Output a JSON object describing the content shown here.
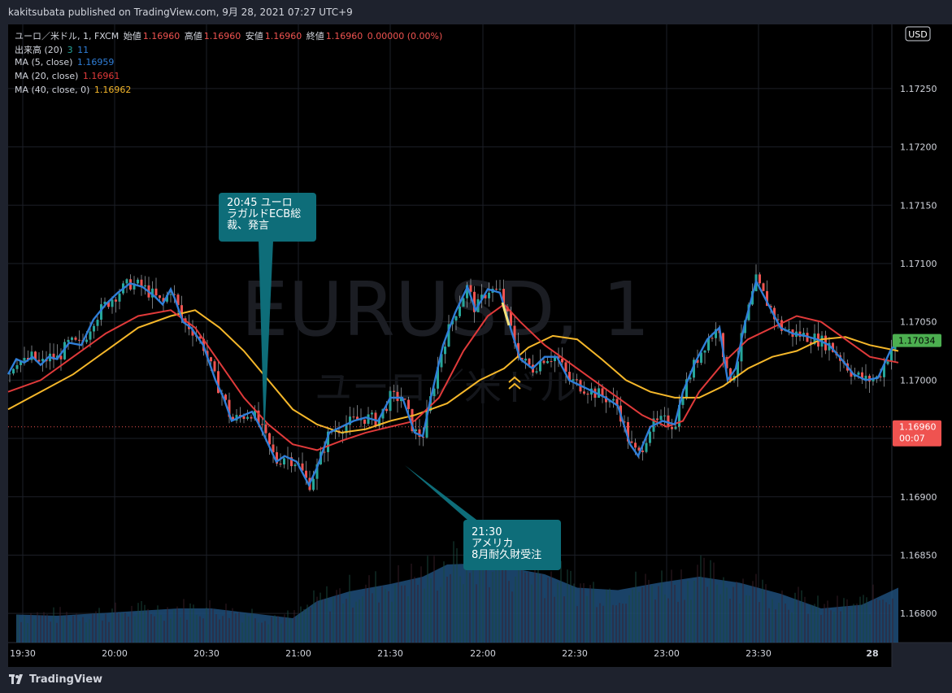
{
  "header": {
    "published_by": "kakitsubata published on TradingView.com, 9月 28, 2021 07:27 UTC+9"
  },
  "legend": {
    "symbol": "ユーロ／米ドル, 1, FXCM",
    "open_label": "始値",
    "open": "1.16960",
    "high_label": "高値",
    "high": "1.16960",
    "low_label": "安値",
    "low": "1.16960",
    "close_label": "終値",
    "close": "1.16960",
    "change": "0.00000 (0.00%)",
    "volume_label": "出来高 (20)",
    "volume_v1": "3",
    "volume_v2": "11",
    "ma5_label": "MA (5, close)",
    "ma5_value": "1.16959",
    "ma20_label": "MA (20, close)",
    "ma20_value": "1.16961",
    "ma40_label": "MA (40, close, 0)",
    "ma40_value": "1.16962"
  },
  "watermark": {
    "line1": "EURUSD, 1",
    "line2": "ユーロ／米ドル"
  },
  "currency_badge": "USD",
  "price_tags": {
    "last_price": "1.17034",
    "current_price": "1.16960",
    "countdown": "00:07"
  },
  "annotations": [
    {
      "text_line1": "20:45 ユーロ",
      "text_line2": "ラガルドECB総",
      "text_line3": "裁、発言"
    },
    {
      "text_line1": "21:30",
      "text_line2": "アメリカ",
      "text_line3": "8月耐久財受注"
    }
  ],
  "brand": "TradingView",
  "colors": {
    "background": "#000000",
    "panel": "#1e222d",
    "up": "#26a69a",
    "down": "#ef5350",
    "ma5": "#2f7ed8",
    "ma20": "#e03a3a",
    "ma40": "#f5b72a",
    "volume": "#1f4e79",
    "callout": "#0e6d79",
    "last_tag": "#4caf50",
    "current_tag": "#ef5350"
  },
  "chart_data": {
    "type": "candlestick",
    "y_ticks": [
      "1.17250",
      "1.17200",
      "1.17150",
      "1.17100",
      "1.17050",
      "1.17000",
      "1.16950",
      "1.16900",
      "1.16850",
      "1.16800"
    ],
    "x_ticks": [
      "19:30",
      "20:00",
      "20:30",
      "21:00",
      "21:30",
      "22:00",
      "22:30",
      "23:00",
      "23:30",
      "28"
    ],
    "ylim": [
      1.16775,
      1.17305
    ],
    "grid": true,
    "price_path": [
      [
        0,
        1.17005
      ],
      [
        10,
        1.17018
      ],
      [
        20,
        1.17015
      ],
      [
        30,
        1.1702
      ],
      [
        40,
        1.17013
      ],
      [
        50,
        1.1702
      ],
      [
        60,
        1.17018
      ],
      [
        75,
        1.17032
      ],
      [
        90,
        1.1703
      ],
      [
        105,
        1.17052
      ],
      [
        120,
        1.17065
      ],
      [
        135,
        1.17075
      ],
      [
        150,
        1.17083
      ],
      [
        165,
        1.1708
      ],
      [
        180,
        1.17072
      ],
      [
        190,
        1.17065
      ],
      [
        200,
        1.17078
      ],
      [
        205,
        1.1707
      ],
      [
        215,
        1.1705
      ],
      [
        225,
        1.17045
      ],
      [
        240,
        1.1703
      ],
      [
        255,
        1.17
      ],
      [
        265,
        1.16985
      ],
      [
        275,
        1.16965
      ],
      [
        290,
        1.1697
      ],
      [
        300,
        1.16973
      ],
      [
        310,
        1.1696
      ],
      [
        320,
        1.16945
      ],
      [
        330,
        1.1693
      ],
      [
        340,
        1.16935
      ],
      [
        355,
        1.1693
      ],
      [
        370,
        1.1691
      ],
      [
        380,
        1.16925
      ],
      [
        395,
        1.16955
      ],
      [
        410,
        1.1696
      ],
      [
        425,
        1.16965
      ],
      [
        440,
        1.16968
      ],
      [
        455,
        1.16965
      ],
      [
        470,
        1.16985
      ],
      [
        485,
        1.16985
      ],
      [
        500,
        1.16955
      ],
      [
        510,
        1.16952
      ],
      [
        520,
        1.16985
      ],
      [
        535,
        1.1703
      ],
      [
        550,
        1.17058
      ],
      [
        565,
        1.1708
      ],
      [
        575,
        1.1706
      ],
      [
        590,
        1.17078
      ],
      [
        605,
        1.17075
      ],
      [
        620,
        1.1704
      ],
      [
        630,
        1.17018
      ],
      [
        645,
        1.1701
      ],
      [
        660,
        1.1702
      ],
      [
        675,
        1.1702
      ],
      [
        690,
        1.17
      ],
      [
        705,
        1.16995
      ],
      [
        720,
        1.1699
      ],
      [
        735,
        1.16985
      ],
      [
        750,
        1.16978
      ],
      [
        765,
        1.16945
      ],
      [
        775,
        1.16935
      ],
      [
        790,
        1.1696
      ],
      [
        805,
        1.16965
      ],
      [
        820,
        1.16962
      ],
      [
        830,
        1.1699
      ],
      [
        845,
        1.17015
      ],
      [
        860,
        1.17035
      ],
      [
        875,
        1.17045
      ],
      [
        885,
        1.17
      ],
      [
        895,
        1.1701
      ],
      [
        905,
        1.17045
      ],
      [
        920,
        1.17085
      ],
      [
        935,
        1.17065
      ],
      [
        950,
        1.17045
      ],
      [
        965,
        1.1704
      ],
      [
        980,
        1.17038
      ],
      [
        995,
        1.17035
      ],
      [
        1010,
        1.1703
      ],
      [
        1025,
        1.17018
      ],
      [
        1040,
        1.17005
      ],
      [
        1055,
        1.17
      ],
      [
        1070,
        1.17002
      ],
      [
        1085,
        1.17025
      ],
      [
        1095,
        1.17034
      ]
    ],
    "ma20_path": [
      [
        0,
        1.1699
      ],
      [
        40,
        1.17
      ],
      [
        80,
        1.1702
      ],
      [
        120,
        1.1704
      ],
      [
        160,
        1.17055
      ],
      [
        200,
        1.1706
      ],
      [
        230,
        1.17045
      ],
      [
        260,
        1.17015
      ],
      [
        290,
        1.16985
      ],
      [
        320,
        1.16962
      ],
      [
        350,
        1.16945
      ],
      [
        380,
        1.1694
      ],
      [
        410,
        1.16948
      ],
      [
        440,
        1.16955
      ],
      [
        470,
        1.1696
      ],
      [
        500,
        1.16965
      ],
      [
        530,
        1.16985
      ],
      [
        560,
        1.17025
      ],
      [
        590,
        1.17055
      ],
      [
        610,
        1.17065
      ],
      [
        630,
        1.1705
      ],
      [
        660,
        1.1703
      ],
      [
        690,
        1.17015
      ],
      [
        720,
        1.17
      ],
      [
        750,
        1.16985
      ],
      [
        780,
        1.1697
      ],
      [
        810,
        1.1696
      ],
      [
        830,
        1.16965
      ],
      [
        850,
        1.1699
      ],
      [
        880,
        1.17015
      ],
      [
        910,
        1.17035
      ],
      [
        940,
        1.17045
      ],
      [
        970,
        1.17055
      ],
      [
        1000,
        1.1705
      ],
      [
        1030,
        1.17035
      ],
      [
        1060,
        1.1702
      ],
      [
        1095,
        1.17015
      ]
    ],
    "ma40_path": [
      [
        0,
        1.16975
      ],
      [
        40,
        1.1699
      ],
      [
        80,
        1.17005
      ],
      [
        120,
        1.17025
      ],
      [
        160,
        1.17045
      ],
      [
        200,
        1.17055
      ],
      [
        230,
        1.1706
      ],
      [
        260,
        1.17045
      ],
      [
        290,
        1.17025
      ],
      [
        320,
        1.17
      ],
      [
        350,
        1.16975
      ],
      [
        380,
        1.16962
      ],
      [
        410,
        1.16955
      ],
      [
        440,
        1.16958
      ],
      [
        470,
        1.16965
      ],
      [
        500,
        1.1697
      ],
      [
        540,
        1.1698
      ],
      [
        580,
        1.17
      ],
      [
        610,
        1.1701
      ],
      [
        640,
        1.17028
      ],
      [
        670,
        1.17038
      ],
      [
        700,
        1.17035
      ],
      [
        730,
        1.17018
      ],
      [
        760,
        1.17
      ],
      [
        790,
        1.1699
      ],
      [
        820,
        1.16985
      ],
      [
        850,
        1.16985
      ],
      [
        880,
        1.16995
      ],
      [
        910,
        1.1701
      ],
      [
        940,
        1.1702
      ],
      [
        970,
        1.17025
      ],
      [
        1000,
        1.17035
      ],
      [
        1030,
        1.17037
      ],
      [
        1060,
        1.1703
      ],
      [
        1095,
        1.17025
      ]
    ],
    "volume_path": [
      [
        10,
        0.23
      ],
      [
        60,
        0.22
      ],
      [
        110,
        0.24
      ],
      [
        160,
        0.26
      ],
      [
        210,
        0.28
      ],
      [
        250,
        0.28
      ],
      [
        300,
        0.24
      ],
      [
        350,
        0.2
      ],
      [
        380,
        0.34
      ],
      [
        420,
        0.42
      ],
      [
        470,
        0.48
      ],
      [
        510,
        0.54
      ],
      [
        540,
        0.64
      ],
      [
        580,
        0.65
      ],
      [
        620,
        0.61
      ],
      [
        660,
        0.56
      ],
      [
        700,
        0.45
      ],
      [
        750,
        0.43
      ],
      [
        800,
        0.49
      ],
      [
        850,
        0.54
      ],
      [
        900,
        0.49
      ],
      [
        950,
        0.4
      ],
      [
        1000,
        0.28
      ],
      [
        1050,
        0.31
      ],
      [
        1095,
        0.45
      ]
    ],
    "last_price": 1.17034,
    "current_price": 1.1696
  }
}
